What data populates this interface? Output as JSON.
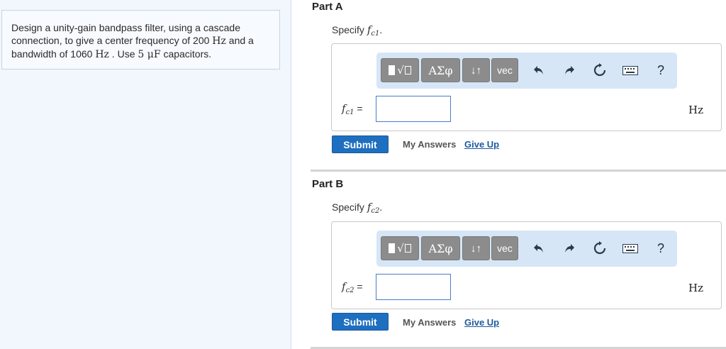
{
  "problem": {
    "text_1": "Design a unity-gain bandpass filter, using a cascade connection, to give a center frequency of 200 ",
    "unit_1": "Hz",
    "text_2": " and a bandwidth of 1060 ",
    "unit_2": "Hz",
    "text_3": " . Use ",
    "cap_value": "5 μF",
    "text_4": " capacitors."
  },
  "toolbar": {
    "templates_label": "√",
    "greek_label": "ΑΣφ",
    "arrows_label": "↓↑",
    "vec_label": "vec",
    "help_label": "?"
  },
  "parts": [
    {
      "title": "Part A",
      "specify_prefix": "Specify ",
      "var": "f",
      "sub": "c1",
      "specify_suffix": ".",
      "label_eq": " =",
      "input_value": "",
      "unit": "Hz",
      "submit_label": "Submit",
      "my_answers_label": "My Answers",
      "give_up_label": "Give Up"
    },
    {
      "title": "Part B",
      "specify_prefix": "Specify ",
      "var": "f",
      "sub": "c2",
      "specify_suffix": ".",
      "label_eq": " =",
      "input_value": "",
      "unit": "Hz",
      "submit_label": "Submit",
      "my_answers_label": "My Answers",
      "give_up_label": "Give Up"
    }
  ]
}
